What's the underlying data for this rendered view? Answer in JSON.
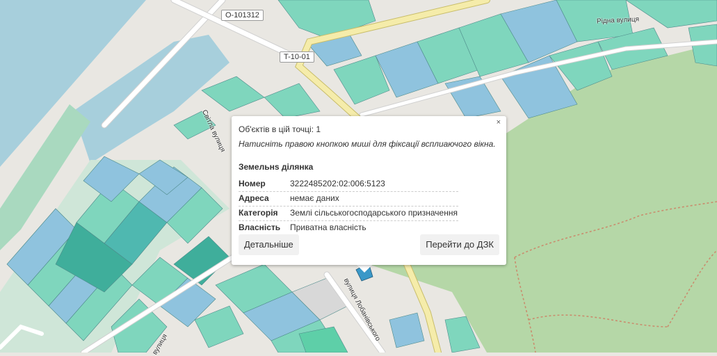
{
  "map": {
    "road_labels": [
      "O-101312",
      "T-10-01"
    ],
    "streets": [
      "Світла вулиця",
      "Рідна вулиця",
      "вулиця Лобанівського",
      "вулиця"
    ],
    "colors": {
      "parcel": "#7fd6bd",
      "parcel_blue": "#8fc3de",
      "forest": "#b5d7a7",
      "water": "#a7cfdc",
      "road_yellow": "#f5ecaa"
    }
  },
  "popup": {
    "close_label": "×",
    "count_text": "Об'єктів в цій точці: 1",
    "hint_text": "Натисніть правою кнопкою миші для фіксації всплиаючого вікна.",
    "title": "Земельнs ділянка",
    "rows": [
      {
        "key": "Номер",
        "value": "3222485202:02:006:5123"
      },
      {
        "key": "Адреса",
        "value": "немає даних"
      },
      {
        "key": "Категорія",
        "value": "Землі сільськогосподарського призначення"
      },
      {
        "key": "Власність",
        "value": "Приватна власність"
      }
    ],
    "details_button": "Детальніше",
    "goto_button": "Перейти до ДЗК"
  }
}
